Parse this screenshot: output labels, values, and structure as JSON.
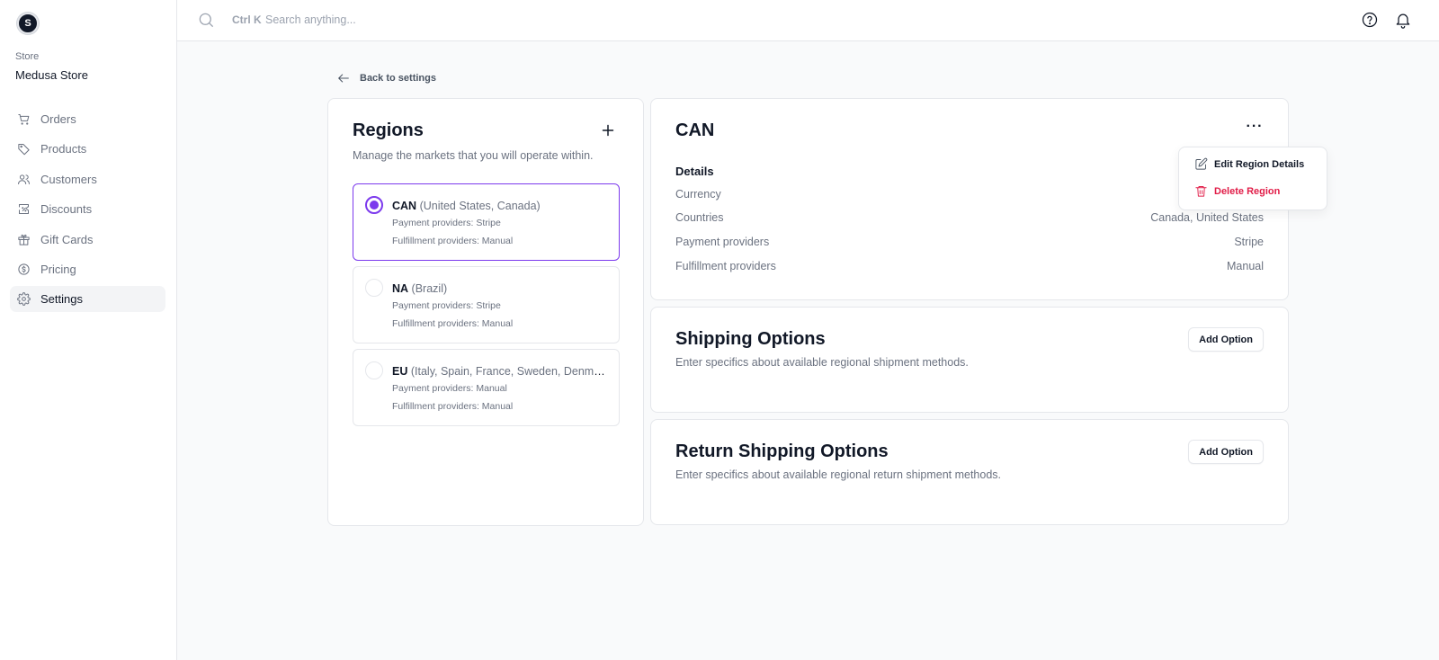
{
  "sidebar": {
    "logo_letter": "S",
    "store_label": "Store",
    "store_name": "Medusa Store",
    "items": [
      {
        "label": "Orders",
        "icon": "cart-icon"
      },
      {
        "label": "Products",
        "icon": "tag-icon"
      },
      {
        "label": "Customers",
        "icon": "users-icon"
      },
      {
        "label": "Discounts",
        "icon": "discount-icon"
      },
      {
        "label": "Gift Cards",
        "icon": "gift-icon"
      },
      {
        "label": "Pricing",
        "icon": "dollar-icon"
      },
      {
        "label": "Settings",
        "icon": "gear-icon",
        "active": true
      }
    ]
  },
  "topbar": {
    "shortcut": "Ctrl K",
    "search_placeholder": "Search anything..."
  },
  "back_label": "Back to settings",
  "regions": {
    "title": "Regions",
    "subtitle": "Manage the markets that you will operate within.",
    "items": [
      {
        "code": "CAN",
        "countries": "(United States, Canada)",
        "payment": "Payment providers: Stripe",
        "fulfillment": "Fulfillment providers: Manual",
        "selected": true
      },
      {
        "code": "NA",
        "countries": "(Brazil)",
        "payment": "Payment providers: Stripe",
        "fulfillment": "Fulfillment providers: Manual",
        "selected": false
      },
      {
        "code": "EU",
        "countries": "(Italy, Spain, France, Sweden, Denmark...)",
        "payment": "Payment providers: Manual",
        "fulfillment": "Fulfillment providers: Manual",
        "selected": false
      }
    ]
  },
  "detail": {
    "title": "CAN",
    "details_label": "Details",
    "rows": [
      {
        "key": "Currency",
        "value": ""
      },
      {
        "key": "Countries",
        "value": "Canada, United States"
      },
      {
        "key": "Payment providers",
        "value": "Stripe"
      },
      {
        "key": "Fulfillment providers",
        "value": "Manual"
      }
    ]
  },
  "shipping": {
    "title": "Shipping Options",
    "subtitle": "Enter specifics about available regional shipment methods.",
    "button": "Add Option"
  },
  "return_shipping": {
    "title": "Return Shipping Options",
    "subtitle": "Enter specifics about available regional return shipment methods.",
    "button": "Add Option"
  },
  "dropdown": {
    "edit_label": "Edit Region Details",
    "delete_label": "Delete Region"
  },
  "colors": {
    "accent": "#7c3aed",
    "danger": "#e11d48"
  }
}
